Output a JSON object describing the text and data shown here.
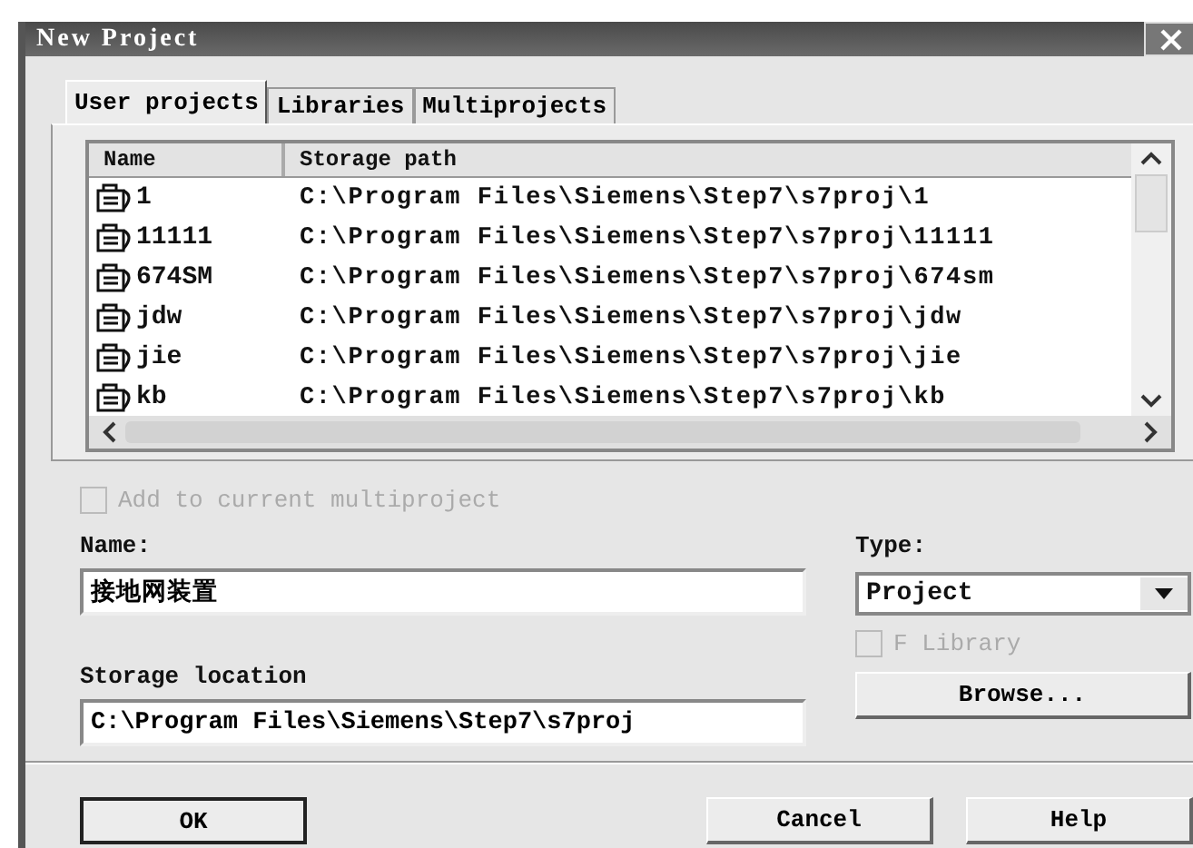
{
  "window": {
    "title": "New Project"
  },
  "tabs": [
    {
      "label": "User projects",
      "selected": true
    },
    {
      "label": "Libraries",
      "selected": false
    },
    {
      "label": "Multiprojects",
      "selected": false
    }
  ],
  "table": {
    "columns": [
      "Name",
      "Storage path"
    ],
    "rows": [
      {
        "name": "1",
        "path": "C:\\Program Files\\Siemens\\Step7\\s7proj\\1"
      },
      {
        "name": "11111",
        "path": "C:\\Program Files\\Siemens\\Step7\\s7proj\\11111"
      },
      {
        "name": "674SM",
        "path": "C:\\Program Files\\Siemens\\Step7\\s7proj\\674sm"
      },
      {
        "name": "jdw",
        "path": "C:\\Program Files\\Siemens\\Step7\\s7proj\\jdw"
      },
      {
        "name": "jie",
        "path": "C:\\Program Files\\Siemens\\Step7\\s7proj\\jie"
      },
      {
        "name": "kb",
        "path": "C:\\Program Files\\Siemens\\Step7\\s7proj\\kb"
      }
    ]
  },
  "add_to_multiproject": {
    "label": "Add to current multiproject",
    "checked": false,
    "disabled": true
  },
  "name_field": {
    "label": "Name:",
    "value": "接地网装置"
  },
  "type_field": {
    "label": "Type:",
    "value": "Project"
  },
  "f_library": {
    "label": "F Library",
    "checked": false,
    "disabled": true
  },
  "storage_field": {
    "label": "Storage location",
    "value": "C:\\Program Files\\Siemens\\Step7\\s7proj"
  },
  "browse_button": {
    "label": "Browse..."
  },
  "buttons": [
    {
      "label": "OK",
      "default": true
    },
    {
      "label": "Cancel",
      "default": false
    },
    {
      "label": "Help",
      "default": false
    }
  ]
}
